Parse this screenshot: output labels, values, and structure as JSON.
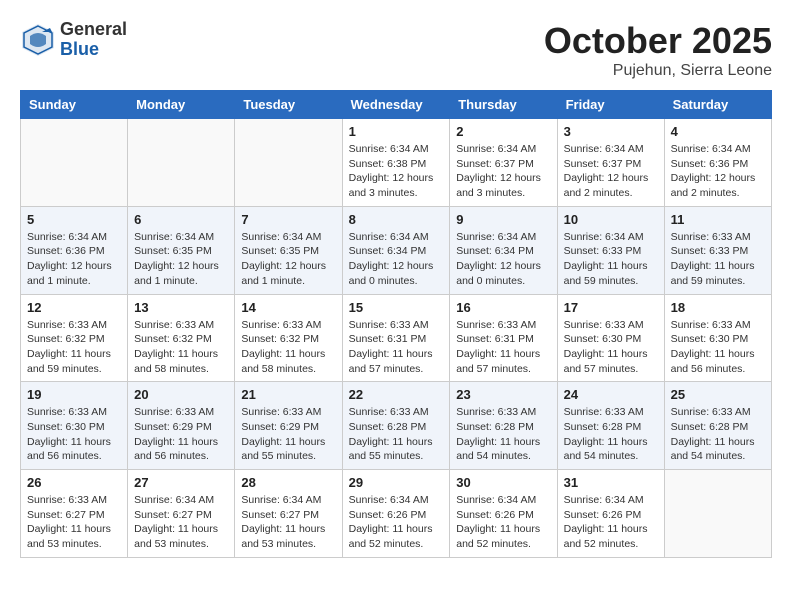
{
  "header": {
    "logo_general": "General",
    "logo_blue": "Blue",
    "title": "October 2025",
    "subtitle": "Pujehun, Sierra Leone"
  },
  "weekdays": [
    "Sunday",
    "Monday",
    "Tuesday",
    "Wednesday",
    "Thursday",
    "Friday",
    "Saturday"
  ],
  "weeks": [
    [
      {
        "day": "",
        "info": ""
      },
      {
        "day": "",
        "info": ""
      },
      {
        "day": "",
        "info": ""
      },
      {
        "day": "1",
        "info": "Sunrise: 6:34 AM\nSunset: 6:38 PM\nDaylight: 12 hours\nand 3 minutes."
      },
      {
        "day": "2",
        "info": "Sunrise: 6:34 AM\nSunset: 6:37 PM\nDaylight: 12 hours\nand 3 minutes."
      },
      {
        "day": "3",
        "info": "Sunrise: 6:34 AM\nSunset: 6:37 PM\nDaylight: 12 hours\nand 2 minutes."
      },
      {
        "day": "4",
        "info": "Sunrise: 6:34 AM\nSunset: 6:36 PM\nDaylight: 12 hours\nand 2 minutes."
      }
    ],
    [
      {
        "day": "5",
        "info": "Sunrise: 6:34 AM\nSunset: 6:36 PM\nDaylight: 12 hours\nand 1 minute."
      },
      {
        "day": "6",
        "info": "Sunrise: 6:34 AM\nSunset: 6:35 PM\nDaylight: 12 hours\nand 1 minute."
      },
      {
        "day": "7",
        "info": "Sunrise: 6:34 AM\nSunset: 6:35 PM\nDaylight: 12 hours\nand 1 minute."
      },
      {
        "day": "8",
        "info": "Sunrise: 6:34 AM\nSunset: 6:34 PM\nDaylight: 12 hours\nand 0 minutes."
      },
      {
        "day": "9",
        "info": "Sunrise: 6:34 AM\nSunset: 6:34 PM\nDaylight: 12 hours\nand 0 minutes."
      },
      {
        "day": "10",
        "info": "Sunrise: 6:34 AM\nSunset: 6:33 PM\nDaylight: 11 hours\nand 59 minutes."
      },
      {
        "day": "11",
        "info": "Sunrise: 6:33 AM\nSunset: 6:33 PM\nDaylight: 11 hours\nand 59 minutes."
      }
    ],
    [
      {
        "day": "12",
        "info": "Sunrise: 6:33 AM\nSunset: 6:32 PM\nDaylight: 11 hours\nand 59 minutes."
      },
      {
        "day": "13",
        "info": "Sunrise: 6:33 AM\nSunset: 6:32 PM\nDaylight: 11 hours\nand 58 minutes."
      },
      {
        "day": "14",
        "info": "Sunrise: 6:33 AM\nSunset: 6:32 PM\nDaylight: 11 hours\nand 58 minutes."
      },
      {
        "day": "15",
        "info": "Sunrise: 6:33 AM\nSunset: 6:31 PM\nDaylight: 11 hours\nand 57 minutes."
      },
      {
        "day": "16",
        "info": "Sunrise: 6:33 AM\nSunset: 6:31 PM\nDaylight: 11 hours\nand 57 minutes."
      },
      {
        "day": "17",
        "info": "Sunrise: 6:33 AM\nSunset: 6:30 PM\nDaylight: 11 hours\nand 57 minutes."
      },
      {
        "day": "18",
        "info": "Sunrise: 6:33 AM\nSunset: 6:30 PM\nDaylight: 11 hours\nand 56 minutes."
      }
    ],
    [
      {
        "day": "19",
        "info": "Sunrise: 6:33 AM\nSunset: 6:30 PM\nDaylight: 11 hours\nand 56 minutes."
      },
      {
        "day": "20",
        "info": "Sunrise: 6:33 AM\nSunset: 6:29 PM\nDaylight: 11 hours\nand 56 minutes."
      },
      {
        "day": "21",
        "info": "Sunrise: 6:33 AM\nSunset: 6:29 PM\nDaylight: 11 hours\nand 55 minutes."
      },
      {
        "day": "22",
        "info": "Sunrise: 6:33 AM\nSunset: 6:28 PM\nDaylight: 11 hours\nand 55 minutes."
      },
      {
        "day": "23",
        "info": "Sunrise: 6:33 AM\nSunset: 6:28 PM\nDaylight: 11 hours\nand 54 minutes."
      },
      {
        "day": "24",
        "info": "Sunrise: 6:33 AM\nSunset: 6:28 PM\nDaylight: 11 hours\nand 54 minutes."
      },
      {
        "day": "25",
        "info": "Sunrise: 6:33 AM\nSunset: 6:28 PM\nDaylight: 11 hours\nand 54 minutes."
      }
    ],
    [
      {
        "day": "26",
        "info": "Sunrise: 6:33 AM\nSunset: 6:27 PM\nDaylight: 11 hours\nand 53 minutes."
      },
      {
        "day": "27",
        "info": "Sunrise: 6:34 AM\nSunset: 6:27 PM\nDaylight: 11 hours\nand 53 minutes."
      },
      {
        "day": "28",
        "info": "Sunrise: 6:34 AM\nSunset: 6:27 PM\nDaylight: 11 hours\nand 53 minutes."
      },
      {
        "day": "29",
        "info": "Sunrise: 6:34 AM\nSunset: 6:26 PM\nDaylight: 11 hours\nand 52 minutes."
      },
      {
        "day": "30",
        "info": "Sunrise: 6:34 AM\nSunset: 6:26 PM\nDaylight: 11 hours\nand 52 minutes."
      },
      {
        "day": "31",
        "info": "Sunrise: 6:34 AM\nSunset: 6:26 PM\nDaylight: 11 hours\nand 52 minutes."
      },
      {
        "day": "",
        "info": ""
      }
    ]
  ]
}
